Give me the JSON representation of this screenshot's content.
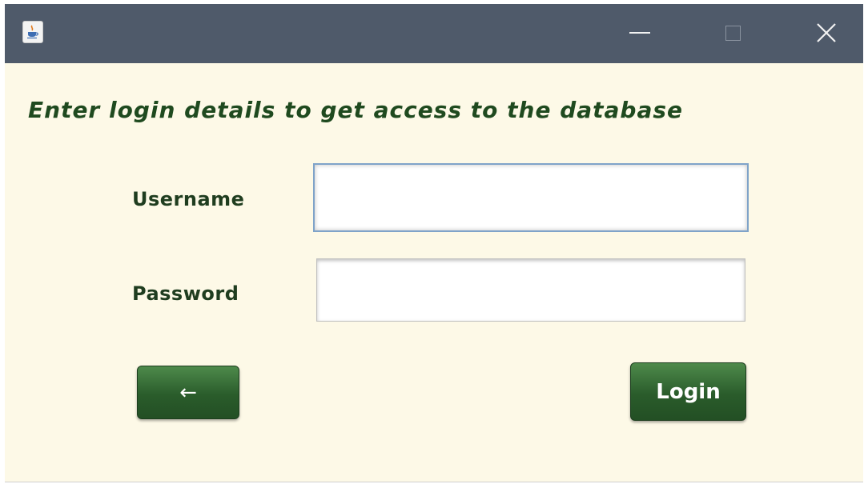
{
  "window": {
    "title": "",
    "controls": {
      "minimize_icon": "minimize-icon",
      "maximize_icon": "maximize-icon",
      "close_icon": "close-icon",
      "close_glyph": "✕"
    },
    "app_icon": "java-cup-icon"
  },
  "form": {
    "headline": "Enter login details to get access to the database",
    "username_label": "Username",
    "password_label": "Password",
    "username_value": "",
    "password_value": ""
  },
  "buttons": {
    "back_label": "←",
    "login_label": "Login"
  },
  "colors": {
    "titlebar": "#4f5a6a",
    "background": "#fdf9e7",
    "accent_green": "#2a5c2b",
    "text_green": "#1f4a1f"
  }
}
